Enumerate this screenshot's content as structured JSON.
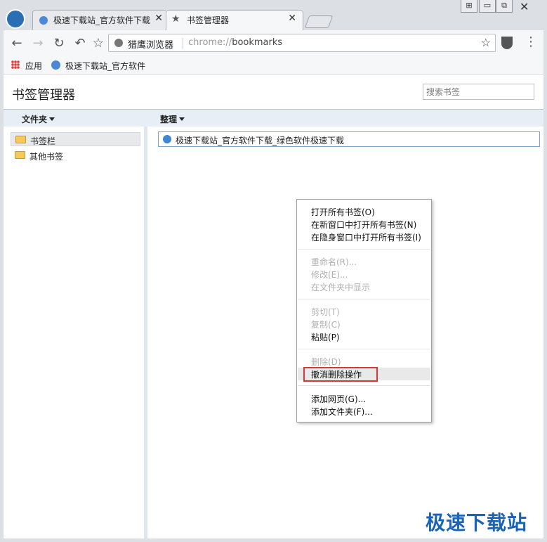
{
  "tabs": [
    {
      "title": "极速下载站_官方软件下载",
      "active": false
    },
    {
      "title": "书签管理器",
      "active": true
    }
  ],
  "window_controls": [
    "⊞",
    "▭",
    "⧉",
    "✕"
  ],
  "toolbar": {
    "site_label": "猎鹰浏览器",
    "url_scheme": "chrome://",
    "url_path": "bookmarks"
  },
  "bookmarks_bar": {
    "apps_label": "应用",
    "items": [
      "极速下载站_官方软件"
    ]
  },
  "page": {
    "title": "书签管理器",
    "search_placeholder": "搜索书签",
    "folders_header": "文件夹",
    "organize_header": "整理",
    "tree": [
      "书签栏",
      "其他书签"
    ],
    "bookmark_rows": [
      "极速下载站_官方软件下载_绿色软件极速下载"
    ]
  },
  "context_menu": {
    "groups": [
      [
        {
          "label": "打开所有书签(O)",
          "enabled": true
        },
        {
          "label": "在新窗口中打开所有书签(N)",
          "enabled": true
        },
        {
          "label": "在隐身窗口中打开所有书签(I)",
          "enabled": true
        }
      ],
      [
        {
          "label": "重命名(R)...",
          "enabled": false
        },
        {
          "label": "修改(E)...",
          "enabled": false
        },
        {
          "label": "在文件夹中显示",
          "enabled": false
        }
      ],
      [
        {
          "label": "剪切(T)",
          "enabled": false
        },
        {
          "label": "复制(C)",
          "enabled": false
        },
        {
          "label": "粘贴(P)",
          "enabled": true
        }
      ],
      [
        {
          "label": "删除(D)",
          "enabled": false
        },
        {
          "label": "撤消删除操作",
          "enabled": true,
          "highlighted": true
        }
      ],
      [
        {
          "label": "添加网页(G)...",
          "enabled": true
        },
        {
          "label": "添加文件夹(F)...",
          "enabled": true
        }
      ]
    ]
  },
  "watermark": "极速下载站",
  "colors": {
    "accent": "#1a63b8",
    "highlight_border": "#d23a3a",
    "header_bg": "#e8eef6"
  }
}
